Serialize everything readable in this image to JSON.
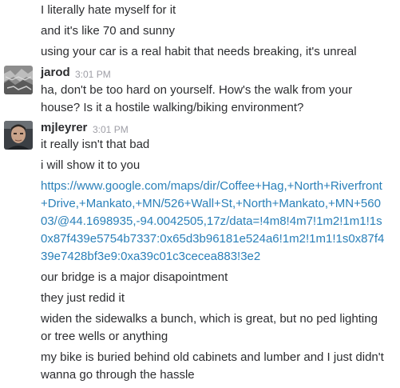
{
  "messages_before": [
    {
      "text": "I literally hate myself for it"
    },
    {
      "text": "and it's like 70 and sunny"
    },
    {
      "text": "using your car is a real habit that needs breaking, it's unreal"
    }
  ],
  "jarod": {
    "author": "jarod",
    "time": "3:01 PM",
    "text": "ha, don't be too hard on yourself. How's the walk from  your house? Is it a hostile walking/biking environment?"
  },
  "mjleyrer": {
    "author": "mjleyrer",
    "time": "3:01 PM",
    "messages": [
      {
        "text": "it really isn't that bad"
      },
      {
        "text": "i will show it to you"
      },
      {
        "text": "https://www.google.com/maps/dir/Coffee+Hag,+North+Riverfront+Drive,+Mankato,+MN/526+Wall+St,+North+Mankato,+MN+56003/@44.1698935,-94.0042505,17z/data=!4m8!4m7!1m2!1m1!1s0x87f439e5754b7337:0x65d3b96181e524a6!1m2!1m1!1s0x87f439e7428bf3e9:0xa39c01c3cecea883!3e2"
      },
      {
        "text": "our bridge is a major disapointment"
      },
      {
        "text": "they just redid it"
      },
      {
        "text": "widen the sidewalks a bunch, which is great, but no ped lighting or tree wells or anything"
      },
      {
        "text": "my bike is buried behind old cabinets and lumber and I just didn't wanna go through the hassle"
      }
    ]
  }
}
